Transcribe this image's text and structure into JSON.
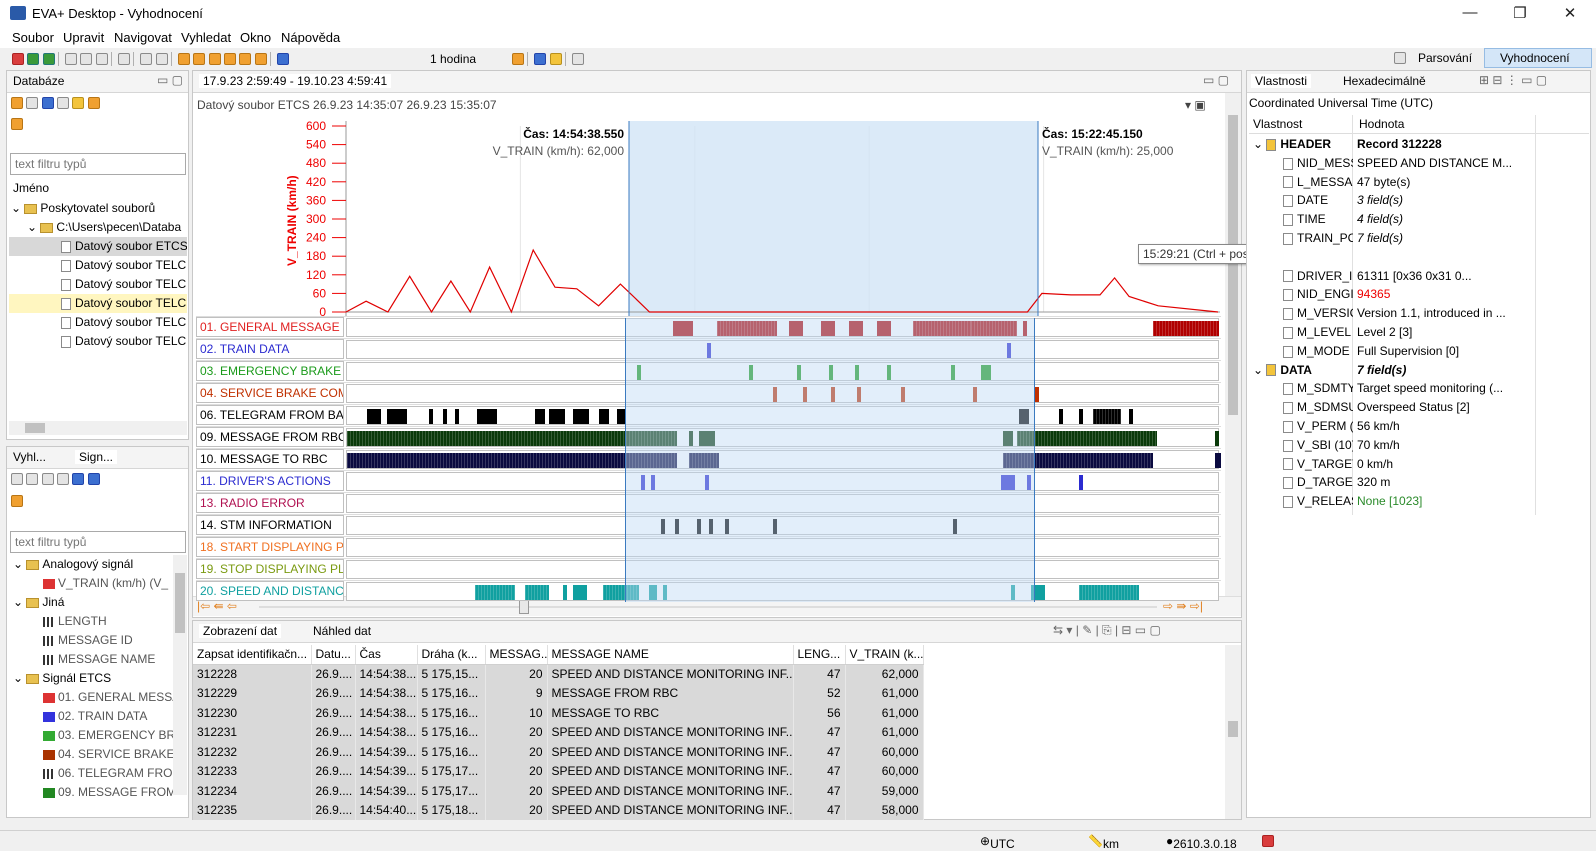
{
  "window": {
    "title": "EVA+ Desktop - Vyhodnocení",
    "minimize": "—",
    "maximize": "❐",
    "close": "✕"
  },
  "menu": [
    "Soubor",
    "Upravit",
    "Navigovat",
    "Vyhledat",
    "Okno",
    "Nápověda"
  ],
  "toolbar": {
    "time_range": "1 hodina",
    "parse_label": "Parsování",
    "eval_label": "Vyhodnocení"
  },
  "db_panel": {
    "tab": "Databáze",
    "filter_placeholder": "text filtru typů",
    "column": "Jméno",
    "tree": [
      "Poskytovatel souborů",
      "C:\\Users\\pecen\\Databa",
      "Datový soubor ETCS",
      "Datový soubor TELC",
      "Datový soubor TELC",
      "Datový soubor TELC",
      "Datový soubor TELC",
      "Datový soubor TELC"
    ]
  },
  "signals_panel": {
    "tab1": "Vyhl...",
    "tab2": "Sign...",
    "filter_placeholder": "text filtru typů",
    "tree": [
      "Analogový signál",
      "V_TRAIN (km/h) (V_",
      "Jiná",
      "LENGTH",
      "MESSAGE ID",
      "MESSAGE NAME",
      "Signál ETCS",
      "01. GENERAL MESSA",
      "02. TRAIN DATA",
      "03. EMERGENCY BR/",
      "04. SERVICE BRAKE",
      "06. TELEGRAM FROI",
      "09. MESSAGE FROM"
    ]
  },
  "chart_panel": {
    "tab": "17.9.23 2:59:49 - 19.10.23 4:59:41",
    "subtitle": "Datový soubor ETCS 26.9.23 14:35:07 26.9.23 15:35:07",
    "y_axis_title": "V_TRAIN (km/h)",
    "cursor1": {
      "time": "Čas: 14:54:38.550",
      "value": "V_TRAIN (km/h): 62,000"
    },
    "cursor2": {
      "time": "Čas: 15:22:45.150",
      "value": "V_TRAIN (km/h): 25,000"
    },
    "tooltip": "15:29:21 (Ctrl + posunutí myší dolů = umístění značky)",
    "signals": [
      {
        "name": "01. GENERAL MESSAGE",
        "color": "#e02020"
      },
      {
        "name": "02. TRAIN DATA",
        "color": "#2b2bd0"
      },
      {
        "name": "03. EMERGENCY BRAKE C...",
        "color": "#1a9a1a"
      },
      {
        "name": "04. SERVICE BRAKE COM...",
        "color": "#c03000"
      },
      {
        "name": "06. TELEGRAM FROM BA...",
        "color": "#000000"
      },
      {
        "name": "09. MESSAGE FROM RBC",
        "color": "#000000"
      },
      {
        "name": "10. MESSAGE TO RBC",
        "color": "#000000"
      },
      {
        "name": "11. DRIVER'S ACTIONS",
        "color": "#2b2bd0"
      },
      {
        "name": "13. RADIO ERROR",
        "color": "#b01050"
      },
      {
        "name": "14. STM INFORMATION",
        "color": "#000000"
      },
      {
        "name": "18. START DISPLAYING PL...",
        "color": "#f07020"
      },
      {
        "name": "19. STOP DISPLAYING PLA...",
        "color": "#7a9a10"
      },
      {
        "name": "20. SPEED AND DISTANC...",
        "color": "#10a0a0"
      }
    ]
  },
  "chart_data": {
    "type": "line",
    "ylabel": "V_TRAIN (km/h)",
    "ylim": [
      0,
      600
    ],
    "yticks": [
      0,
      60,
      120,
      180,
      240,
      300,
      360,
      420,
      480,
      540,
      600
    ],
    "x_range": [
      "14:35:07",
      "15:35:07"
    ],
    "x": [
      "14:35:07",
      "14:36:30",
      "14:38:00",
      "14:39:30",
      "14:41:00",
      "14:42:20",
      "14:43:40",
      "14:45:00",
      "14:46:30",
      "14:48:00",
      "14:49:30",
      "14:51:00",
      "14:52:30",
      "14:54:00",
      "14:54:38",
      "14:56:00",
      "15:10:00",
      "15:22:00",
      "15:23:00",
      "15:25:00",
      "15:27:00",
      "15:28:00",
      "15:29:00",
      "15:31:00",
      "15:35:07"
    ],
    "values": [
      0,
      35,
      0,
      115,
      0,
      100,
      0,
      145,
      0,
      200,
      80,
      75,
      20,
      90,
      62,
      0,
      0,
      0,
      60,
      55,
      55,
      110,
      50,
      20,
      0
    ]
  },
  "data_panel": {
    "tab1": "Zobrazení dat",
    "tab2": "Náhled dat",
    "columns": [
      "Zapsat identifikačn...",
      "Datu...",
      "Čas",
      "Dráha (k...",
      "MESSAG...",
      "MESSAGE NAME",
      "LENG...",
      "V_TRAIN (k..."
    ],
    "rows": [
      [
        "312228",
        "26.9....",
        "14:54:38....",
        "5 175,15...",
        "20",
        "SPEED AND DISTANCE MONITORING INF...",
        "47",
        "62,000"
      ],
      [
        "312229",
        "26.9....",
        "14:54:38....",
        "5 175,16...",
        "9",
        "MESSAGE FROM RBC",
        "52",
        "61,000"
      ],
      [
        "312230",
        "26.9....",
        "14:54:38....",
        "5 175,16...",
        "10",
        "MESSAGE TO RBC",
        "56",
        "61,000"
      ],
      [
        "312231",
        "26.9....",
        "14:54:38....",
        "5 175,16...",
        "20",
        "SPEED AND DISTANCE MONITORING INF...",
        "47",
        "61,000"
      ],
      [
        "312232",
        "26.9....",
        "14:54:39....",
        "5 175,16...",
        "20",
        "SPEED AND DISTANCE MONITORING INF...",
        "47",
        "60,000"
      ],
      [
        "312233",
        "26.9....",
        "14:54:39....",
        "5 175,17...",
        "20",
        "SPEED AND DISTANCE MONITORING INF...",
        "47",
        "60,000"
      ],
      [
        "312234",
        "26.9....",
        "14:54:39....",
        "5 175,17...",
        "20",
        "SPEED AND DISTANCE MONITORING INF...",
        "47",
        "59,000"
      ],
      [
        "312235",
        "26.9....",
        "14:54:40....",
        "5 175,18...",
        "20",
        "SPEED AND DISTANCE MONITORING INF...",
        "47",
        "58,000"
      ]
    ]
  },
  "props_panel": {
    "tab1": "Vlastnosti",
    "tab2": "Hexadecimálně",
    "subtitle": "Coordinated Universal Time (UTC)",
    "col_prop": "Vlastnost",
    "col_val": "Hodnota",
    "rows": [
      {
        "k": "HEADER",
        "v": "Record 312228",
        "lvl": 0,
        "bold": true
      },
      {
        "k": "NID_MESS",
        "v": "SPEED AND DISTANCE M...",
        "lvl": 1
      },
      {
        "k": "L_MESSAC",
        "v": "47 byte(s)",
        "lvl": 1
      },
      {
        "k": "DATE",
        "v": "3 field(s)",
        "lvl": 1,
        "italic": true
      },
      {
        "k": "TIME",
        "v": "4 field(s)",
        "lvl": 1,
        "italic": true
      },
      {
        "k": "TRAIN_PC",
        "v": "7 field(s)",
        "lvl": 1,
        "italic": true
      },
      {
        "k": "",
        "v": "",
        "lvl": 1
      },
      {
        "k": "DRIVER_II",
        "v": "61311          [0x36 0x31 0...",
        "lvl": 1
      },
      {
        "k": "NID_ENGI",
        "v": "94365",
        "lvl": 1,
        "red": true
      },
      {
        "k": "M_VERSIC",
        "v": "Version 1.1, introduced in ...",
        "lvl": 1
      },
      {
        "k": "M_LEVEL",
        "v": "Level 2 [3]",
        "lvl": 1
      },
      {
        "k": "M_MODE",
        "v": "Full Supervision [0]",
        "lvl": 1
      },
      {
        "k": "DATA",
        "v": "7 field(s)",
        "lvl": 0,
        "bold": true,
        "italic": true
      },
      {
        "k": "M_SDMTY",
        "v": "Target speed monitoring (...",
        "lvl": 1
      },
      {
        "k": "M_SDMSU",
        "v": "Overspeed Status [2]",
        "lvl": 1
      },
      {
        "k": "V_PERM (",
        "v": "56 km/h",
        "lvl": 1
      },
      {
        "k": "V_SBI (10)",
        "v": "70 km/h",
        "lvl": 1
      },
      {
        "k": "V_TARGET",
        "v": "0 km/h",
        "lvl": 1
      },
      {
        "k": "D_TARGET",
        "v": "320 m",
        "lvl": 1
      },
      {
        "k": "V_RELEAS",
        "v": "None [1023]",
        "lvl": 1,
        "green": true
      }
    ]
  },
  "status": {
    "tz": "UTC",
    "unit": "km",
    "version": "2610.3.0.18"
  }
}
